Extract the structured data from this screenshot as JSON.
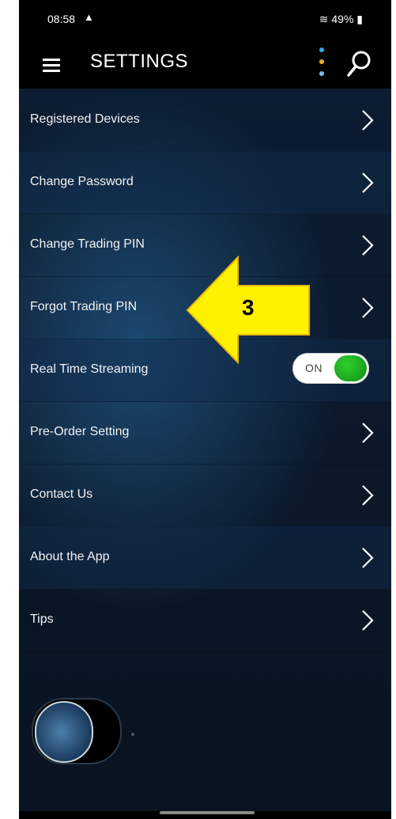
{
  "status_bar": {
    "time": "08:58",
    "warning_glyph": "▲",
    "right_text": "📶 LTE 49%🔋",
    "battery": "49%"
  },
  "app_bar": {
    "title": "SETTINGS",
    "menu_icon": "hamburger-menu-icon",
    "more_icon": "kebab-menu-icon",
    "search_icon": "search-icon"
  },
  "settings": [
    {
      "label": "Registered Devices",
      "type": "link"
    },
    {
      "label": "Change Password",
      "type": "link"
    },
    {
      "label": "Change Trading PIN",
      "type": "link"
    },
    {
      "label": "Forgot Trading PIN",
      "type": "link"
    },
    {
      "label": "Real Time Streaming",
      "type": "toggle",
      "toggle_label": "ON",
      "on": true
    },
    {
      "label": "Pre-Order Setting",
      "type": "link"
    },
    {
      "label": "Contact Us",
      "type": "link"
    },
    {
      "label": "About the App",
      "type": "link"
    },
    {
      "label": "Tips",
      "type": "link"
    }
  ],
  "annotation": {
    "number": "3",
    "fill_color": "#fff200",
    "stroke_color": "#e8b800"
  },
  "colors": {
    "background": "#0b1522",
    "toggle_on": "#1db31d",
    "text": "#f2f2f2"
  }
}
